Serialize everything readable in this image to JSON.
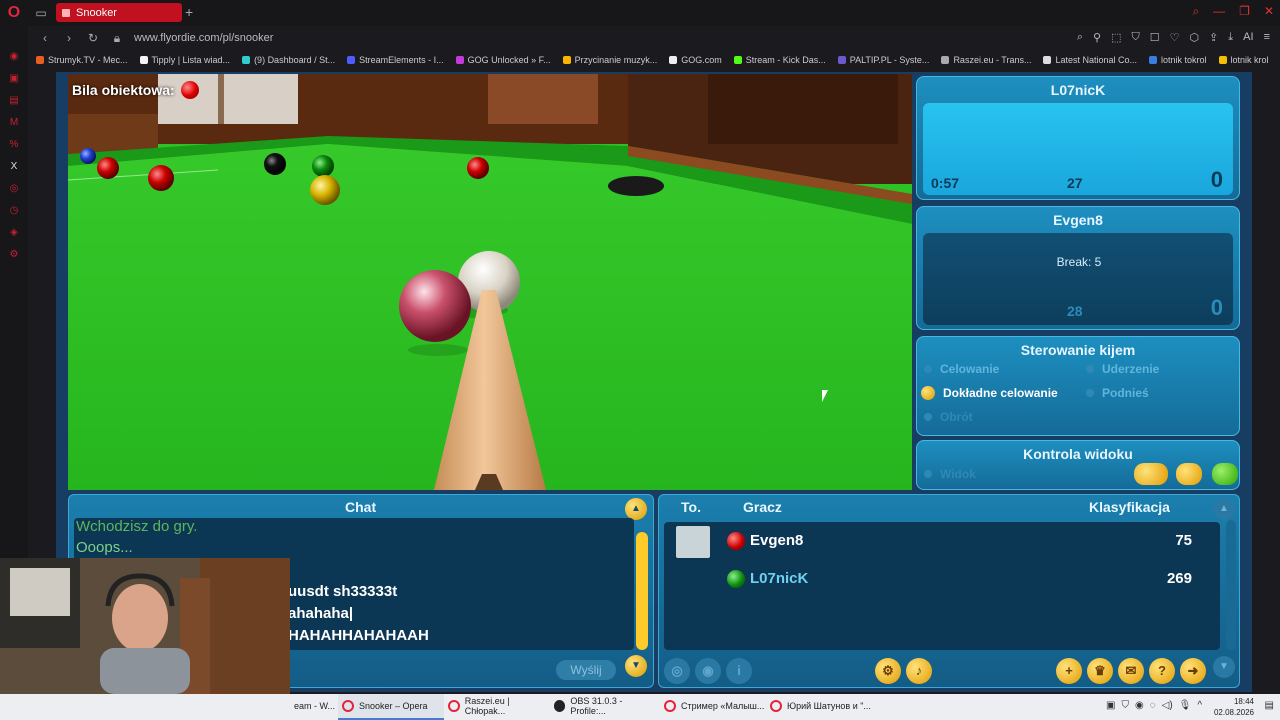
{
  "browser": {
    "tab_title": "Snooker",
    "url": "www.flyordie.com/pl/snooker",
    "bookmarks": [
      "Strumyk.TV - Mec...",
      "Tipply | Lista wiad...",
      "(9) Dashboard / St...",
      "StreamElements - I...",
      "GOG Unlocked » F...",
      "Przycinanie muzyk...",
      "GOG.com",
      "Stream - Kick Das...",
      "PALTIP.PL - Syste...",
      "Raszei.eu - Trans...",
      "Latest National Co...",
      "lotnik tokrol",
      "lotnik krol"
    ],
    "ai_label": "AI"
  },
  "game": {
    "object_ball_label": "Bila obiektowa:",
    "player1": {
      "name": "L07nicK",
      "time": "0:57",
      "points_left": "27",
      "score": "0"
    },
    "player2": {
      "name": "Evgen8",
      "break_text": "Break: 5",
      "points_left": "28",
      "score": "0"
    },
    "cue_control": {
      "title": "Sterowanie kijem",
      "items": {
        "aim": "Celowanie",
        "strike": "Uderzenie",
        "fine_aim": "Dokładne celowanie",
        "raise": "Podnieś",
        "spin": "Obrót"
      }
    },
    "view_control": {
      "title": "Kontrola widoku",
      "view": "Widok"
    }
  },
  "chat": {
    "title": "Chat",
    "lines": [
      "Wchodzisz do gry.",
      "Ooops...",
      "uusdt sh33333t",
      "ahahaha|",
      "HAHAHHAHAHAAH"
    ],
    "send_label": "Wyślij"
  },
  "players_table": {
    "col_to": "To.",
    "col_player": "Gracz",
    "col_rank": "Klasyfikacja",
    "rows": [
      {
        "name": "Evgen8",
        "rank": "75",
        "color": "#d81c1c"
      },
      {
        "name": "L07nicK",
        "rank": "269",
        "color": "#1aa51a"
      }
    ]
  },
  "taskbar": {
    "items": [
      "eam - W...",
      "Snooker – Opera",
      "Raszei.eu | Chłopak...",
      "OBS 31.0.3 - Profile:...",
      "Стример «Малыш...",
      "Юрий Шатунов и \"..."
    ],
    "time": "18:44",
    "date": "02.08.2026"
  },
  "colors": {
    "accent": "#c1101f",
    "panel": "#1d8fc0",
    "felt": "#2ec325"
  }
}
